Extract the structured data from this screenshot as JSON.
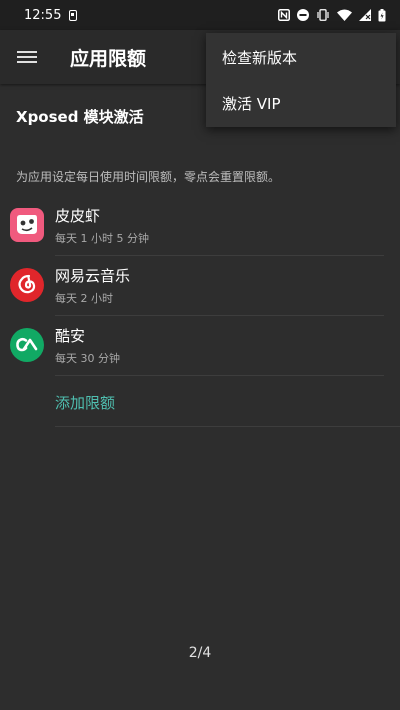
{
  "status_bar": {
    "time": "12:55",
    "icons": [
      "notification-icon",
      "nfc-icon",
      "dnd-icon",
      "vibrate-icon",
      "wifi-icon",
      "signal-icon",
      "battery-icon"
    ]
  },
  "app_bar": {
    "title": "应用限额",
    "menu_icon": "hamburger-menu-icon"
  },
  "overflow_menu": {
    "items": [
      {
        "label": "检查新版本"
      },
      {
        "label": "激活 VIP"
      }
    ]
  },
  "main": {
    "xposed_title": "Xposed 模块激活",
    "description": "为应用设定每日使用时间限额，零点会重置限额。",
    "apps": [
      {
        "name": "皮皮虾",
        "limit": "每天 1 小时 5 分钟",
        "icon": "pipixia-app-icon",
        "color": "#f05a7e"
      },
      {
        "name": "网易云音乐",
        "limit": "每天 2 小时",
        "icon": "netease-music-app-icon",
        "color": "#e0262b"
      },
      {
        "name": "酷安",
        "limit": "每天 30 分钟",
        "icon": "coolapk-app-icon",
        "color": "#11a964"
      }
    ],
    "add_label": "添加限额",
    "add_color": "#4fbfb0"
  },
  "page_indicator": "2/4"
}
